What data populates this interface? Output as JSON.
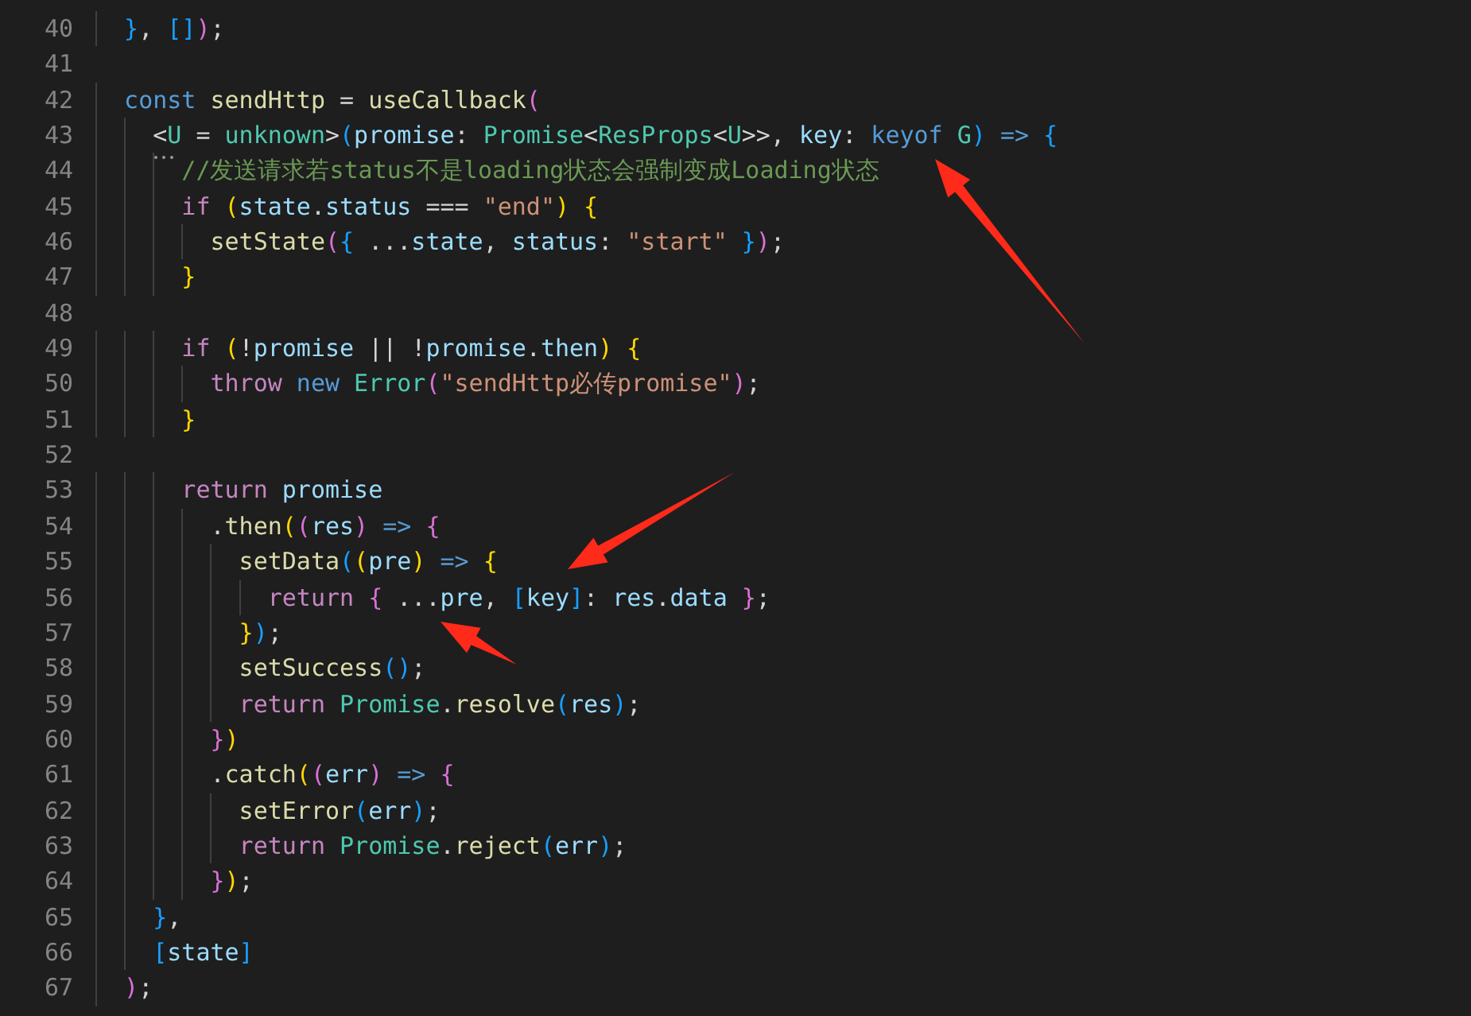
{
  "editor": {
    "lines": [
      {
        "number": "40",
        "tokens": [
          {
            "text": "}",
            "kind": "b3"
          },
          {
            "text": ", ",
            "kind": "p"
          },
          {
            "text": "[]",
            "kind": "b3"
          },
          {
            "text": ")",
            "kind": "b2"
          },
          {
            "text": ";",
            "kind": "p"
          }
        ]
      },
      {
        "number": "41"
      },
      {
        "number": "42",
        "tokens": [
          {
            "text": "const ",
            "kind": "kw"
          },
          {
            "text": "sendHttp",
            "kind": "fn"
          },
          {
            "text": " = ",
            "kind": "p"
          },
          {
            "text": "useCallback",
            "kind": "fn"
          },
          {
            "text": "(",
            "kind": "b2"
          }
        ],
        "children": [
          {
            "number": "43",
            "tokens": [
              {
                "text": "<",
                "kind": "p"
              },
              {
                "text": "U",
                "kind": "type"
              },
              {
                "text": " = ",
                "kind": "p"
              },
              {
                "text": "unknown",
                "kind": "type"
              },
              {
                "text": ">",
                "kind": "p"
              },
              {
                "text": "(",
                "kind": "b3"
              },
              {
                "text": "promise",
                "kind": "var"
              },
              {
                "text": ": ",
                "kind": "p"
              },
              {
                "text": "Promise",
                "kind": "type"
              },
              {
                "text": "<",
                "kind": "p"
              },
              {
                "text": "ResProps",
                "kind": "type"
              },
              {
                "text": "<",
                "kind": "p"
              },
              {
                "text": "U",
                "kind": "type"
              },
              {
                "text": ">>, ",
                "kind": "p"
              },
              {
                "text": "key",
                "kind": "var"
              },
              {
                "text": ": ",
                "kind": "p"
              },
              {
                "text": "keyof ",
                "kind": "kw"
              },
              {
                "text": "G",
                "kind": "type"
              },
              {
                "text": ") ",
                "kind": "b3"
              },
              {
                "text": "=> ",
                "kind": "kw"
              },
              {
                "text": "{",
                "kind": "b3"
              }
            ],
            "children": [
              {
                "number": "44",
                "tokens": [
                  {
                    "text": "//发送请求若status不是loading状态会强制变成Loading状态",
                    "kind": "cmt"
                  }
                ]
              },
              {
                "number": "45",
                "tokens": [
                  {
                    "text": "if ",
                    "kind": "ctl"
                  },
                  {
                    "text": "(",
                    "kind": "b1"
                  },
                  {
                    "text": "state",
                    "kind": "var"
                  },
                  {
                    "text": ".",
                    "kind": "p"
                  },
                  {
                    "text": "status",
                    "kind": "var"
                  },
                  {
                    "text": " === ",
                    "kind": "p"
                  },
                  {
                    "text": "\"end\"",
                    "kind": "str"
                  },
                  {
                    "text": ") {",
                    "kind": "b1"
                  }
                ],
                "children": [
                  {
                    "number": "46",
                    "tokens": [
                      {
                        "text": "setState",
                        "kind": "fn"
                      },
                      {
                        "text": "(",
                        "kind": "b2"
                      },
                      {
                        "text": "{",
                        "kind": "b3"
                      },
                      {
                        "text": " ...",
                        "kind": "p"
                      },
                      {
                        "text": "state",
                        "kind": "var"
                      },
                      {
                        "text": ", ",
                        "kind": "p"
                      },
                      {
                        "text": "status",
                        "kind": "var"
                      },
                      {
                        "text": ": ",
                        "kind": "p"
                      },
                      {
                        "text": "\"start\" ",
                        "kind": "str"
                      },
                      {
                        "text": "}",
                        "kind": "b3"
                      },
                      {
                        "text": ")",
                        "kind": "b2"
                      },
                      {
                        "text": ";",
                        "kind": "p"
                      }
                    ]
                  }
                ]
              },
              {
                "number": "47",
                "tokens": [
                  {
                    "text": "}",
                    "kind": "b1"
                  }
                ]
              },
              {
                "number": "48"
              },
              {
                "number": "49",
                "tokens": [
                  {
                    "text": "if ",
                    "kind": "ctl"
                  },
                  {
                    "text": "(",
                    "kind": "b1"
                  },
                  {
                    "text": "!",
                    "kind": "p"
                  },
                  {
                    "text": "promise",
                    "kind": "var"
                  },
                  {
                    "text": " || !",
                    "kind": "p"
                  },
                  {
                    "text": "promise",
                    "kind": "var"
                  },
                  {
                    "text": ".",
                    "kind": "p"
                  },
                  {
                    "text": "then",
                    "kind": "var"
                  },
                  {
                    "text": ") {",
                    "kind": "b1"
                  }
                ],
                "children": [
                  {
                    "number": "50",
                    "tokens": [
                      {
                        "text": "throw ",
                        "kind": "ctl"
                      },
                      {
                        "text": "new ",
                        "kind": "kw"
                      },
                      {
                        "text": "Error",
                        "kind": "type"
                      },
                      {
                        "text": "(",
                        "kind": "b2"
                      },
                      {
                        "text": "\"sendHttp必传promise\"",
                        "kind": "str"
                      },
                      {
                        "text": ")",
                        "kind": "b2"
                      },
                      {
                        "text": ";",
                        "kind": "p"
                      }
                    ]
                  }
                ]
              },
              {
                "number": "51",
                "tokens": [
                  {
                    "text": "}",
                    "kind": "b1"
                  }
                ]
              },
              {
                "number": "52"
              },
              {
                "number": "53",
                "tokens": [
                  {
                    "text": "return ",
                    "kind": "ctl"
                  },
                  {
                    "text": "promise",
                    "kind": "var"
                  }
                ],
                "children": [
                  {
                    "number": "54",
                    "tokens": [
                      {
                        "text": ".",
                        "kind": "p"
                      },
                      {
                        "text": "then",
                        "kind": "fn"
                      },
                      {
                        "text": "(",
                        "kind": "b1"
                      },
                      {
                        "text": "(",
                        "kind": "b2"
                      },
                      {
                        "text": "res",
                        "kind": "var"
                      },
                      {
                        "text": ") ",
                        "kind": "b2"
                      },
                      {
                        "text": "=> ",
                        "kind": "kw"
                      },
                      {
                        "text": "{",
                        "kind": "b2"
                      }
                    ],
                    "children": [
                      {
                        "number": "55",
                        "tokens": [
                          {
                            "text": "setData",
                            "kind": "fn"
                          },
                          {
                            "text": "(",
                            "kind": "b3"
                          },
                          {
                            "text": "(",
                            "kind": "b1"
                          },
                          {
                            "text": "pre",
                            "kind": "var"
                          },
                          {
                            "text": ") ",
                            "kind": "b1"
                          },
                          {
                            "text": "=> ",
                            "kind": "kw"
                          },
                          {
                            "text": "{",
                            "kind": "b1"
                          }
                        ],
                        "children": [
                          {
                            "number": "56",
                            "tokens": [
                              {
                                "text": "return ",
                                "kind": "ctl"
                              },
                              {
                                "text": "{",
                                "kind": "b2"
                              },
                              {
                                "text": " ...",
                                "kind": "p"
                              },
                              {
                                "text": "pre",
                                "kind": "var"
                              },
                              {
                                "text": ", ",
                                "kind": "p"
                              },
                              {
                                "text": "[",
                                "kind": "b3"
                              },
                              {
                                "text": "key",
                                "kind": "var"
                              },
                              {
                                "text": "]",
                                "kind": "b3"
                              },
                              {
                                "text": ": ",
                                "kind": "p"
                              },
                              {
                                "text": "res",
                                "kind": "var"
                              },
                              {
                                "text": ".",
                                "kind": "p"
                              },
                              {
                                "text": "data ",
                                "kind": "var"
                              },
                              {
                                "text": "}",
                                "kind": "b2"
                              },
                              {
                                "text": ";",
                                "kind": "p"
                              }
                            ]
                          }
                        ]
                      },
                      {
                        "number": "57",
                        "tokens": [
                          {
                            "text": "}",
                            "kind": "b1"
                          },
                          {
                            "text": ")",
                            "kind": "b3"
                          },
                          {
                            "text": ";",
                            "kind": "p"
                          }
                        ]
                      },
                      {
                        "number": "58",
                        "tokens": [
                          {
                            "text": "setSuccess",
                            "kind": "fn"
                          },
                          {
                            "text": "()",
                            "kind": "b3"
                          },
                          {
                            "text": ";",
                            "kind": "p"
                          }
                        ]
                      },
                      {
                        "number": "59",
                        "tokens": [
                          {
                            "text": "return ",
                            "kind": "ctl"
                          },
                          {
                            "text": "Promise",
                            "kind": "type"
                          },
                          {
                            "text": ".",
                            "kind": "p"
                          },
                          {
                            "text": "resolve",
                            "kind": "fn"
                          },
                          {
                            "text": "(",
                            "kind": "b3"
                          },
                          {
                            "text": "res",
                            "kind": "var"
                          },
                          {
                            "text": ")",
                            "kind": "b3"
                          },
                          {
                            "text": ";",
                            "kind": "p"
                          }
                        ]
                      }
                    ]
                  },
                  {
                    "number": "60",
                    "tokens": [
                      {
                        "text": "}",
                        "kind": "b2"
                      },
                      {
                        "text": ")",
                        "kind": "b1"
                      }
                    ]
                  },
                  {
                    "number": "61",
                    "tokens": [
                      {
                        "text": ".",
                        "kind": "p"
                      },
                      {
                        "text": "catch",
                        "kind": "fn"
                      },
                      {
                        "text": "(",
                        "kind": "b1"
                      },
                      {
                        "text": "(",
                        "kind": "b2"
                      },
                      {
                        "text": "err",
                        "kind": "var"
                      },
                      {
                        "text": ") ",
                        "kind": "b2"
                      },
                      {
                        "text": "=> ",
                        "kind": "kw"
                      },
                      {
                        "text": "{",
                        "kind": "b2"
                      }
                    ],
                    "children": [
                      {
                        "number": "62",
                        "tokens": [
                          {
                            "text": "setError",
                            "kind": "fn"
                          },
                          {
                            "text": "(",
                            "kind": "b3"
                          },
                          {
                            "text": "err",
                            "kind": "var"
                          },
                          {
                            "text": ")",
                            "kind": "b3"
                          },
                          {
                            "text": ";",
                            "kind": "p"
                          }
                        ]
                      },
                      {
                        "number": "63",
                        "tokens": [
                          {
                            "text": "return ",
                            "kind": "ctl"
                          },
                          {
                            "text": "Promise",
                            "kind": "type"
                          },
                          {
                            "text": ".",
                            "kind": "p"
                          },
                          {
                            "text": "reject",
                            "kind": "fn"
                          },
                          {
                            "text": "(",
                            "kind": "b3"
                          },
                          {
                            "text": "err",
                            "kind": "var"
                          },
                          {
                            "text": ")",
                            "kind": "b3"
                          },
                          {
                            "text": ";",
                            "kind": "p"
                          }
                        ]
                      }
                    ]
                  },
                  {
                    "number": "64",
                    "tokens": [
                      {
                        "text": "}",
                        "kind": "b2"
                      },
                      {
                        "text": ")",
                        "kind": "b1"
                      },
                      {
                        "text": ";",
                        "kind": "p"
                      }
                    ]
                  }
                ]
              }
            ]
          },
          {
            "number": "65",
            "tokens": [
              {
                "text": "}",
                "kind": "b3"
              },
              {
                "text": ",",
                "kind": "p"
              }
            ]
          },
          {
            "number": "66",
            "tokens": [
              {
                "text": "[",
                "kind": "b3"
              },
              {
                "text": "state",
                "kind": "var"
              },
              {
                "text": "]",
                "kind": "b3"
              }
            ]
          }
        ]
      },
      {
        "number": "67",
        "tokens": [
          {
            "text": ")",
            "kind": "b2"
          },
          {
            "text": ";",
            "kind": "p"
          }
        ]
      }
    ]
  }
}
